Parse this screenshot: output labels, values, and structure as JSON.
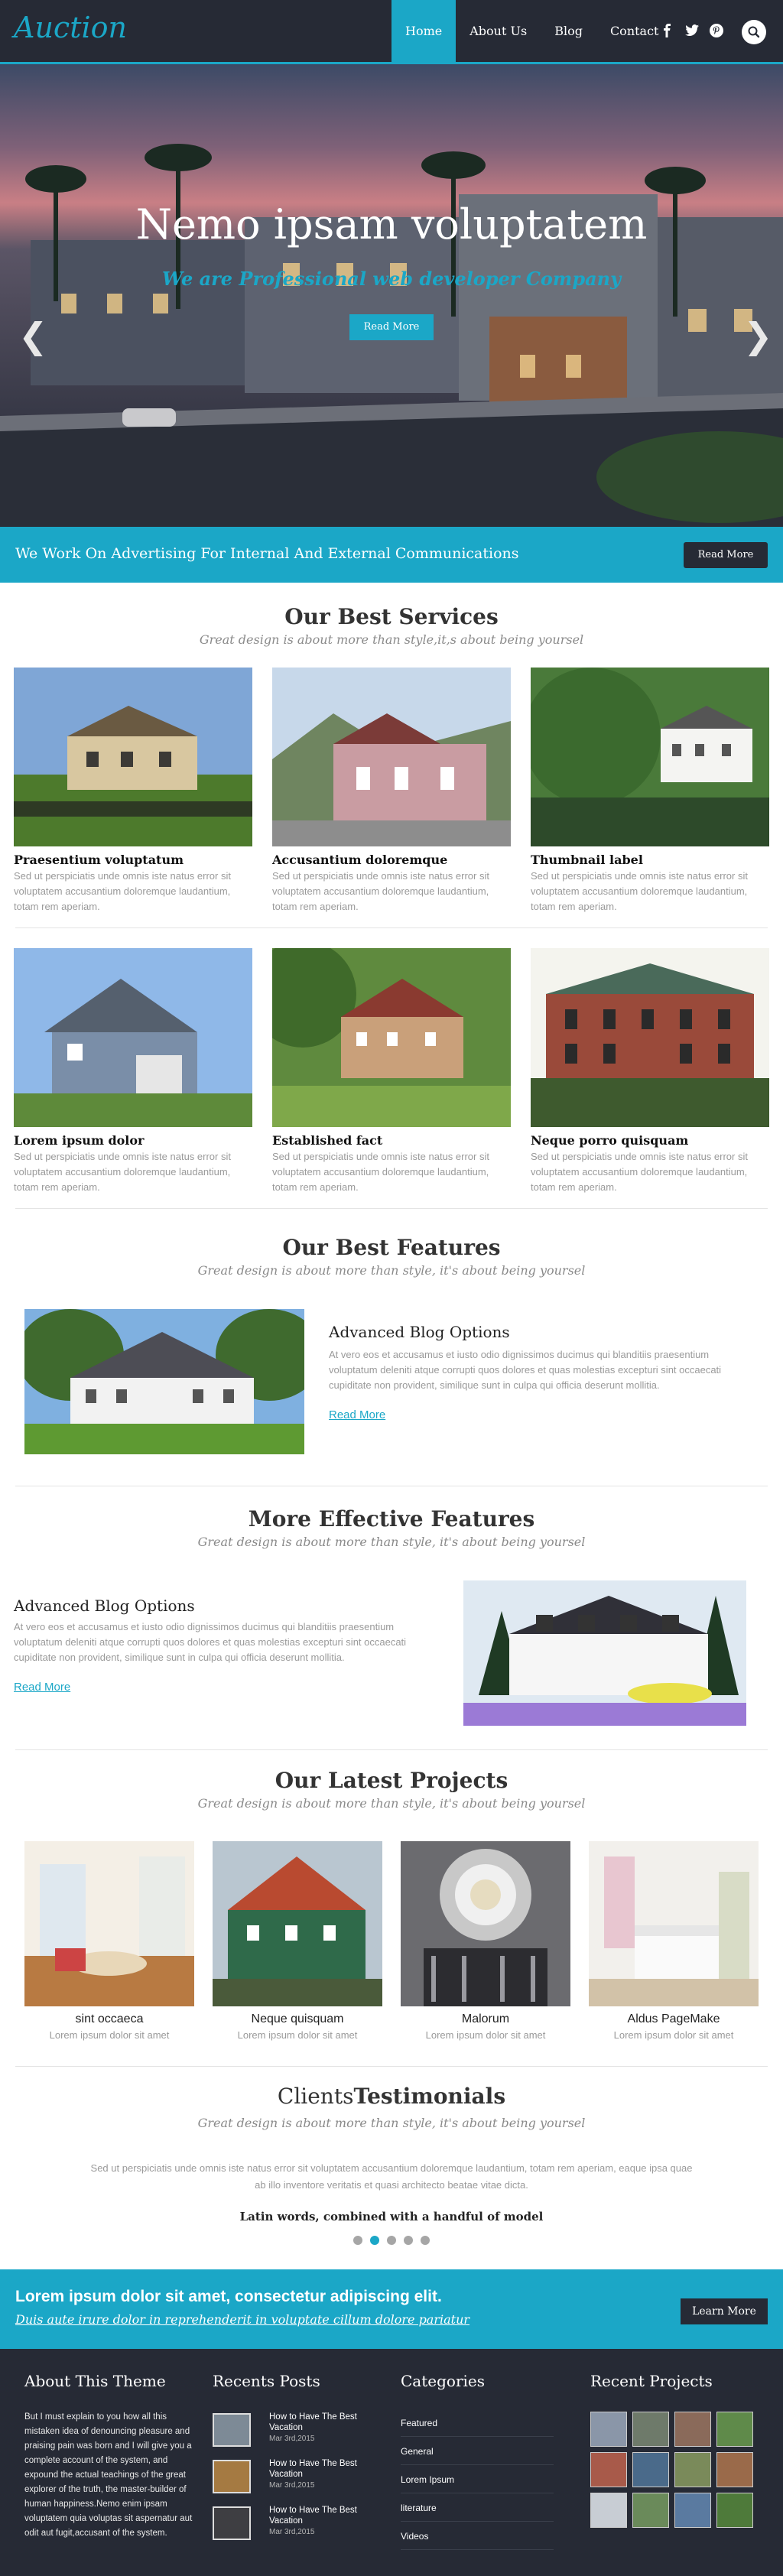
{
  "header": {
    "logo": "Auction",
    "nav": [
      "Home",
      "About Us",
      "Blog",
      "Contact"
    ],
    "social_icons": [
      "facebook-icon",
      "twitter-icon",
      "pinterest-icon"
    ],
    "search_icon": "search-icon"
  },
  "hero": {
    "title": "Nemo ipsam voluptatem",
    "subtitle": "We are Professional web developer Company",
    "button": "Read More",
    "prev_icon": "chevron-left-icon",
    "next_icon": "chevron-right-icon"
  },
  "banner": {
    "text": "We Work On Advertising For Internal And External Communications",
    "button": "Read More"
  },
  "services": {
    "title": "Our Best Services",
    "subtitle": "Great design is about more than style,it,s about being yoursel",
    "items": [
      {
        "title": "Praesentium voluptatum",
        "text": "Sed ut perspiciatis unde omnis iste natus error sit voluptatem accusantium doloremque laudantium, totam rem aperiam."
      },
      {
        "title": "Accusantium doloremque",
        "text": "Sed ut perspiciatis unde omnis iste natus error sit voluptatem accusantium doloremque laudantium, totam rem aperiam."
      },
      {
        "title": "Thumbnail label",
        "text": "Sed ut perspiciatis unde omnis iste natus error sit voluptatem accusantium doloremque laudantium, totam rem aperiam."
      },
      {
        "title": "Lorem ipsum dolor",
        "text": "Sed ut perspiciatis unde omnis iste natus error sit voluptatem accusantium doloremque laudantium, totam rem aperiam."
      },
      {
        "title": "Established fact",
        "text": "Sed ut perspiciatis unde omnis iste natus error sit voluptatem accusantium doloremque laudantium, totam rem aperiam."
      },
      {
        "title": "Neque porro quisquam",
        "text": "Sed ut perspiciatis unde omnis iste natus error sit voluptatem accusantium doloremque laudantium, totam rem aperiam."
      }
    ]
  },
  "features": {
    "title": "Our Best Features",
    "subtitle": "Great design is about more than style, it's about being yoursel",
    "item_title": "Advanced Blog Options",
    "item_text": "At vero eos et accusamus et iusto odio dignissimos ducimus qui blanditiis praesentium voluptatum deleniti atque corrupti quos dolores et quas molestias excepturi sint occaecati cupiditate non provident, similique sunt in culpa qui officia deserunt mollitia.",
    "link": "Read More"
  },
  "more_features": {
    "title": "More Effective Features",
    "subtitle": "Great design is about more than style, it's about being yoursel",
    "item_title": "Advanced Blog Options",
    "item_text": "At vero eos et accusamus et iusto odio dignissimos ducimus qui blanditiis praesentium voluptatum deleniti atque corrupti quos dolores et quas molestias excepturi sint occaecati cupiditate non provident, similique sunt in culpa qui officia deserunt mollitia.",
    "link": "Read More"
  },
  "projects": {
    "title": "Our Latest Projects",
    "subtitle": "Great design is about more than style, it's about being yoursel",
    "items": [
      {
        "title": "sint occaeca",
        "text": "Lorem ipsum dolor sit amet"
      },
      {
        "title": "Neque quisquam",
        "text": "Lorem ipsum dolor sit amet"
      },
      {
        "title": "Malorum",
        "text": "Lorem ipsum dolor sit amet"
      },
      {
        "title": "Aldus PageMake",
        "text": "Lorem ipsum dolor sit amet"
      }
    ]
  },
  "testimonials": {
    "title_light": "Clients",
    "title_bold": "Testimonials",
    "subtitle": "Great design is about more than style, it's about being yoursel",
    "quote": "Sed ut perspiciatis unde omnis iste natus error sit voluptatem accusantium doloremque laudantium, totam rem aperiam, eaque ipsa quae ab illo inventore veritatis et quasi architecto beatae vitae dicta.",
    "author": "Latin words, combined with a handful of model",
    "dots": 5,
    "active_dot": 2
  },
  "cta": {
    "title": "Lorem ipsum dolor sit amet, consectetur adipiscing elit.",
    "subtitle": "Duis aute irure dolor in reprehenderit in voluptate cillum dolore pariatur",
    "button": "Learn More"
  },
  "footer": {
    "about_title": "About This Theme",
    "about_text": "But I must explain to you how all this mistaken idea of denouncing pleasure and praising pain was born and I will give you a complete account of the system, and expound the actual teachings of the great explorer of the truth, the master-builder of human happiness.Nemo enim ipsam voluptatem quia voluptas sit aspernatur aut odit aut fugit,accusant of the system.",
    "posts_title": "Recents Posts",
    "posts": [
      {
        "title": "How to Have The Best Vacation",
        "date": "Mar 3rd,2015"
      },
      {
        "title": "How to Have The Best Vacation",
        "date": "Mar 3rd,2015"
      },
      {
        "title": "How to Have The Best Vacation",
        "date": "Mar 3rd,2015"
      }
    ],
    "categories_title": "Categories",
    "categories": [
      "Featured",
      "General",
      "Lorem Ipsum",
      "literature",
      "Videos"
    ],
    "projects_title": "Recent Projects"
  }
}
